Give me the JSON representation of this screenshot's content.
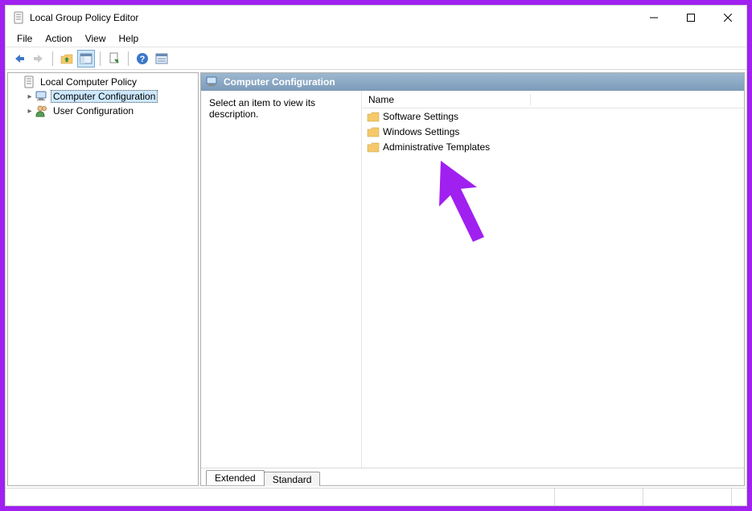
{
  "window": {
    "title": "Local Group Policy Editor"
  },
  "menu": {
    "items": [
      "File",
      "Action",
      "View",
      "Help"
    ]
  },
  "tree": {
    "root": "Local Computer Policy",
    "children": [
      {
        "label": "Computer Configuration",
        "selected": true
      },
      {
        "label": "User Configuration",
        "selected": false
      }
    ]
  },
  "content": {
    "header": "Computer Configuration",
    "description": "Select an item to view its description.",
    "column_header": "Name",
    "items": [
      "Software Settings",
      "Windows Settings",
      "Administrative Templates"
    ]
  },
  "tabs": {
    "extended": "Extended",
    "standard": "Standard"
  }
}
